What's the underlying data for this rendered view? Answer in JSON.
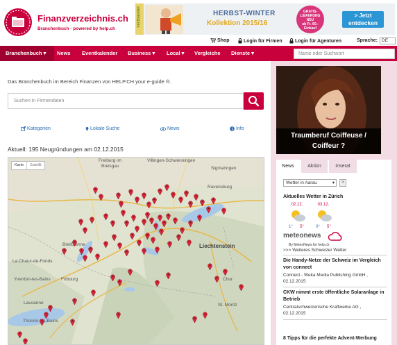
{
  "header": {
    "logo_title": "Finanzverzeichnis.ch",
    "logo_sub": "Branchenbuch - powered by help.ch",
    "logo_icon": "folder-icon",
    "banner": {
      "side_text": "vertbaudet",
      "line1": "HERBST-WINTER",
      "line2": "Kollektion 2015/16",
      "badge": [
        "GRATIS-",
        "LIEFERUNG",
        "NEU",
        "ab Fr. 60.-",
        "Einkauf"
      ],
      "button_l1": "> Jetzt",
      "button_l2": "entdecken"
    },
    "shop": "Shop",
    "login_firmen": "Login für Firmen",
    "login_agenturen": "Login für Agenturen",
    "sprache_label": "Sprache:",
    "sprache_value": "DE"
  },
  "nav": {
    "items": [
      "Branchenbuch",
      "News",
      "Eventkalender",
      "Business",
      "Local",
      "Vergleiche",
      "Dienste"
    ],
    "search_placeholder": "Name oder Suchwort"
  },
  "main": {
    "intro": "Das Branchenbuch im Bereich Finanzen von HELP.CH your e-guide ®.",
    "search_placeholder": "Suchen in Firmendaten",
    "links": [
      "Kategorien",
      "Lokale Suche",
      "News",
      "Info"
    ],
    "aktuell": "Aktuell: 195 Neugründungen am 02.12.2015",
    "map_tabs": [
      "Karte",
      "Satellit"
    ],
    "map_labels": [
      "Freiburg im",
      "Breisgau",
      "Villingen-Schwenningen",
      "Sigmaringen",
      "Ravensburg",
      "Liechtenstein",
      "La Chaux-de-Fonds",
      "Yverdon-les-Bains",
      "Fribourg",
      "Lausanne",
      "Thonon-les-Bains",
      "Chur",
      "St. Moritz",
      "Biel/Bienne"
    ]
  },
  "sidebar": {
    "ad_caption_l1": "Traumberuf Coiffeuse /",
    "ad_caption_l2": "Coiffeur ?",
    "tabs": [
      "News",
      "Aktion",
      "Inserat"
    ],
    "weather_select": "Wetter in Aarau",
    "weather_go": ">",
    "weather_title": "Aktuelles Wetter in Zürich",
    "days": [
      "02.12.",
      "03.12."
    ],
    "temps": [
      "1°",
      "5°",
      "0°",
      "5°"
    ],
    "meteo_brand": "meteonews",
    "meteo_sub": "By MeteoNews for help.ch",
    "meteo_link": ">>> Weiteres Schweizer Wetter",
    "news": [
      {
        "title": "Die Handy-Netze der Schweiz im Vergleich von connect",
        "source": "Connect - Weka Media Publishing GmbH ,",
        "date": "02.12.2015"
      },
      {
        "title": "CKW nimmt erste öffentliche Solaranlage in Betrieb",
        "source": "Centralschweizerische Kraftwerke AG ,",
        "date": "02.12.2015"
      },
      {
        "title": "8 Tipps für die perfekte Advent-Werbung",
        "source": "",
        "date": ""
      }
    ]
  }
}
